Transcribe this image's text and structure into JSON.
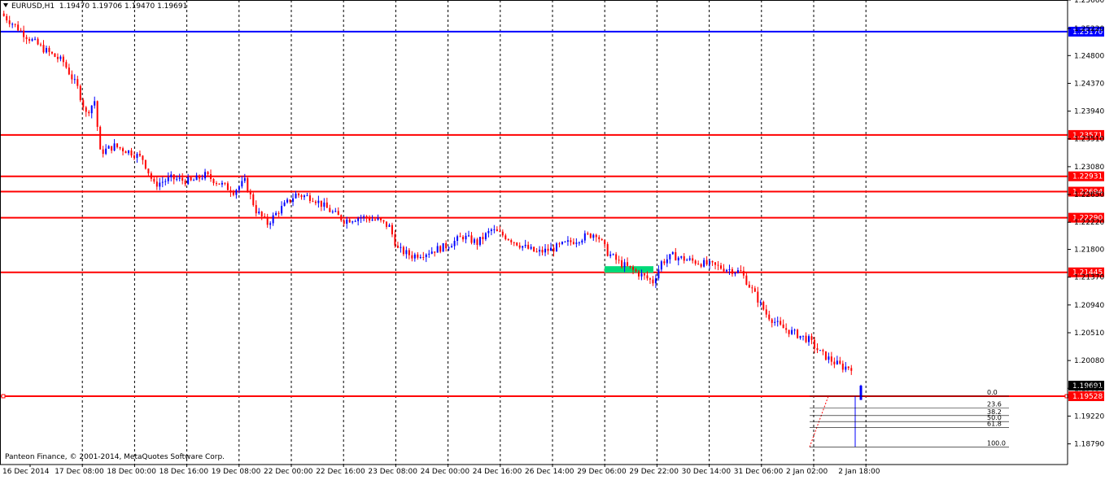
{
  "header": {
    "symbol": "EURUSD,H1",
    "ohlc": "1.19470 1.19706 1.19470 1.19691"
  },
  "footer": {
    "copyright": "Panteon Finance, © 2001-2014, MetaQuotes Software Corp."
  },
  "colors": {
    "background": "#ffffff",
    "bull_candle": "#0000ff",
    "bear_candle": "#ff0000",
    "support_resistance": "#ff0000",
    "upper_line": "#0000ff",
    "highlight_box": "#00d977",
    "fibonacci": "#000000"
  },
  "chart_data": {
    "type": "candlestick",
    "symbol": "EURUSD",
    "timeframe": "H1",
    "ylim": [
      1.1847,
      1.2566
    ],
    "y_ticks": [
      "1.25660",
      "1.25220",
      "1.24800",
      "1.24370",
      "1.23940",
      "1.23510",
      "1.23080",
      "1.22650",
      "1.22220",
      "1.21800",
      "1.21370",
      "1.20940",
      "1.20510",
      "1.20080",
      "1.19650",
      "1.19220",
      "1.18790"
    ],
    "x_ticks": [
      "16 Dec 2014",
      "17 Dec 08:00",
      "18 Dec 00:00",
      "18 Dec 16:00",
      "19 Dec 08:00",
      "22 Dec 00:00",
      "22 Dec 16:00",
      "23 Dec 08:00",
      "24 Dec 00:00",
      "24 Dec 16:00",
      "26 Dec 14:00",
      "29 Dec 06:00",
      "29 Dec 22:00",
      "30 Dec 14:00",
      "31 Dec 06:00",
      "2 Jan 02:00",
      "2 Jan 18:00"
    ],
    "horizontal_levels": [
      {
        "price": 1.2517,
        "label": "1.25170",
        "color": "#0000ff"
      },
      {
        "price": 1.23571,
        "label": "1.23571",
        "color": "#ff0000"
      },
      {
        "price": 1.22931,
        "label": "1.22931",
        "color": "#ff0000"
      },
      {
        "price": 1.22694,
        "label": "1.22694",
        "color": "#ff0000"
      },
      {
        "price": 1.2229,
        "label": "1.22290",
        "color": "#ff0000"
      },
      {
        "price": 1.21445,
        "label": "1.21445",
        "color": "#ff0000"
      },
      {
        "price": 1.19528,
        "label": "1.19528",
        "color": "#ff0000"
      }
    ],
    "current_price": {
      "price": 1.19691,
      "label": "1.19691"
    },
    "fibonacci": [
      {
        "label": "0.0",
        "price": 1.19528
      },
      {
        "label": "23.6",
        "price": 1.19342
      },
      {
        "label": "38.2",
        "price": 1.19228
      },
      {
        "label": "50.0",
        "price": 1.19135
      },
      {
        "label": "61.8",
        "price": 1.19042
      },
      {
        "label": "100.0",
        "price": 1.18742
      }
    ],
    "highlight_zone": {
      "price_low": 1.2144,
      "price_high": 1.2154
    },
    "price_path": [
      [
        0,
        1.2545
      ],
      [
        4,
        1.253
      ],
      [
        9,
        1.251
      ],
      [
        15,
        1.249
      ],
      [
        22,
        1.247
      ],
      [
        27,
        1.243
      ],
      [
        30,
        1.239
      ],
      [
        33,
        1.241
      ],
      [
        35,
        1.233
      ],
      [
        40,
        1.234
      ],
      [
        46,
        1.233
      ],
      [
        50,
        1.232
      ],
      [
        54,
        1.228
      ],
      [
        60,
        1.229
      ],
      [
        67,
        1.2285
      ],
      [
        72,
        1.2295
      ],
      [
        78,
        1.228
      ],
      [
        82,
        1.227
      ],
      [
        86,
        1.2285
      ],
      [
        90,
        1.224
      ],
      [
        94,
        1.222
      ],
      [
        98,
        1.224
      ],
      [
        104,
        1.2265
      ],
      [
        110,
        1.226
      ],
      [
        116,
        1.224
      ],
      [
        121,
        1.2225
      ],
      [
        127,
        1.223
      ],
      [
        133,
        1.2225
      ],
      [
        137,
        1.2215
      ],
      [
        140,
        1.218
      ],
      [
        145,
        1.217
      ],
      [
        150,
        1.2175
      ],
      [
        157,
        1.2185
      ],
      [
        163,
        1.22
      ],
      [
        168,
        1.219
      ],
      [
        173,
        1.221
      ],
      [
        178,
        1.22
      ],
      [
        184,
        1.2185
      ],
      [
        189,
        1.2175
      ],
      [
        194,
        1.218
      ],
      [
        200,
        1.219
      ],
      [
        206,
        1.22
      ],
      [
        210,
        1.2205
      ],
      [
        214,
        1.2175
      ],
      [
        218,
        1.216
      ],
      [
        222,
        1.215
      ],
      [
        226,
        1.214
      ],
      [
        230,
        1.213
      ],
      [
        233,
        1.216
      ],
      [
        237,
        1.217
      ],
      [
        241,
        1.2165
      ],
      [
        246,
        1.216
      ],
      [
        251,
        1.2155
      ],
      [
        256,
        1.215
      ],
      [
        261,
        1.2145
      ],
      [
        266,
        1.211
      ],
      [
        270,
        1.208
      ],
      [
        275,
        1.206
      ],
      [
        280,
        1.205
      ],
      [
        285,
        1.204
      ],
      [
        289,
        1.202
      ],
      [
        294,
        1.2005
      ],
      [
        297,
        1.1998
      ]
    ],
    "last_candle": {
      "open": 1.1947,
      "high": 1.19706,
      "low": 1.1947,
      "close": 1.19691
    }
  }
}
